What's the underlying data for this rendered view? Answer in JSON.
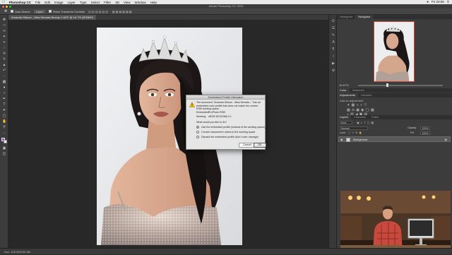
{
  "menubar": {
    "app_name": "Photoshop CC",
    "items": [
      "File",
      "Edit",
      "Image",
      "Layer",
      "Type",
      "Select",
      "Filter",
      "3D",
      "View",
      "Window",
      "Help"
    ],
    "clock": "Fri 20:06"
  },
  "window": {
    "title": "Adobe Photoshop CC 2015"
  },
  "options_bar": {
    "auto_select": "Auto-Select:",
    "layer_select": "Layer",
    "show_transform": "Show Transform Controls"
  },
  "document": {
    "tab_label": "Amanda Gibson - Miss Nevada Beauty 1.NEF @ 16.7% (RGB/8*)"
  },
  "dialog": {
    "title": "Embedded Profile Mismatch",
    "message": "The document \"Amanda Gibson - Miss Nevada...\" has an embedded color profile that does not match the current RGB working space.",
    "embedded_label": "Embedded:",
    "embedded_value": "ProPhoto RGB",
    "working_label": "Working:",
    "working_value": "sRGB IEC61966-2.1",
    "question": "What would you like to do?",
    "options": [
      "Use the embedded profile (instead of the working space)",
      "Convert document's colors to the working space",
      "Discard the embedded profile (don't color manage)"
    ],
    "selected_option": 0,
    "cancel_label": "Cancel",
    "ok_label": "OK"
  },
  "panels": {
    "navigator_tabs": [
      "Histogram",
      "Navigator"
    ],
    "navigator_active": 1,
    "zoom": "16.67%",
    "color_tabs": [
      "Color",
      "Swatches"
    ],
    "adjust_tabs": [
      "Adjustments",
      "Libraries"
    ],
    "adjust_hint": "Add an adjustment",
    "layer_tabs": [
      "Layers",
      "Channels",
      "Paths"
    ],
    "kind_label": "Kind",
    "blend_mode": "Normal",
    "opacity_label": "Opacity:",
    "opacity_value": "100%",
    "lock_label": "Lock:",
    "fill_label": "Fill:",
    "fill_value": "100%",
    "layer_name": "Background"
  },
  "statusbar": {
    "text": "Doc: 105.6M/105.6M"
  },
  "colors": {
    "accent": "#2f7fd8",
    "dialog_bg": "#e6e6e6"
  }
}
